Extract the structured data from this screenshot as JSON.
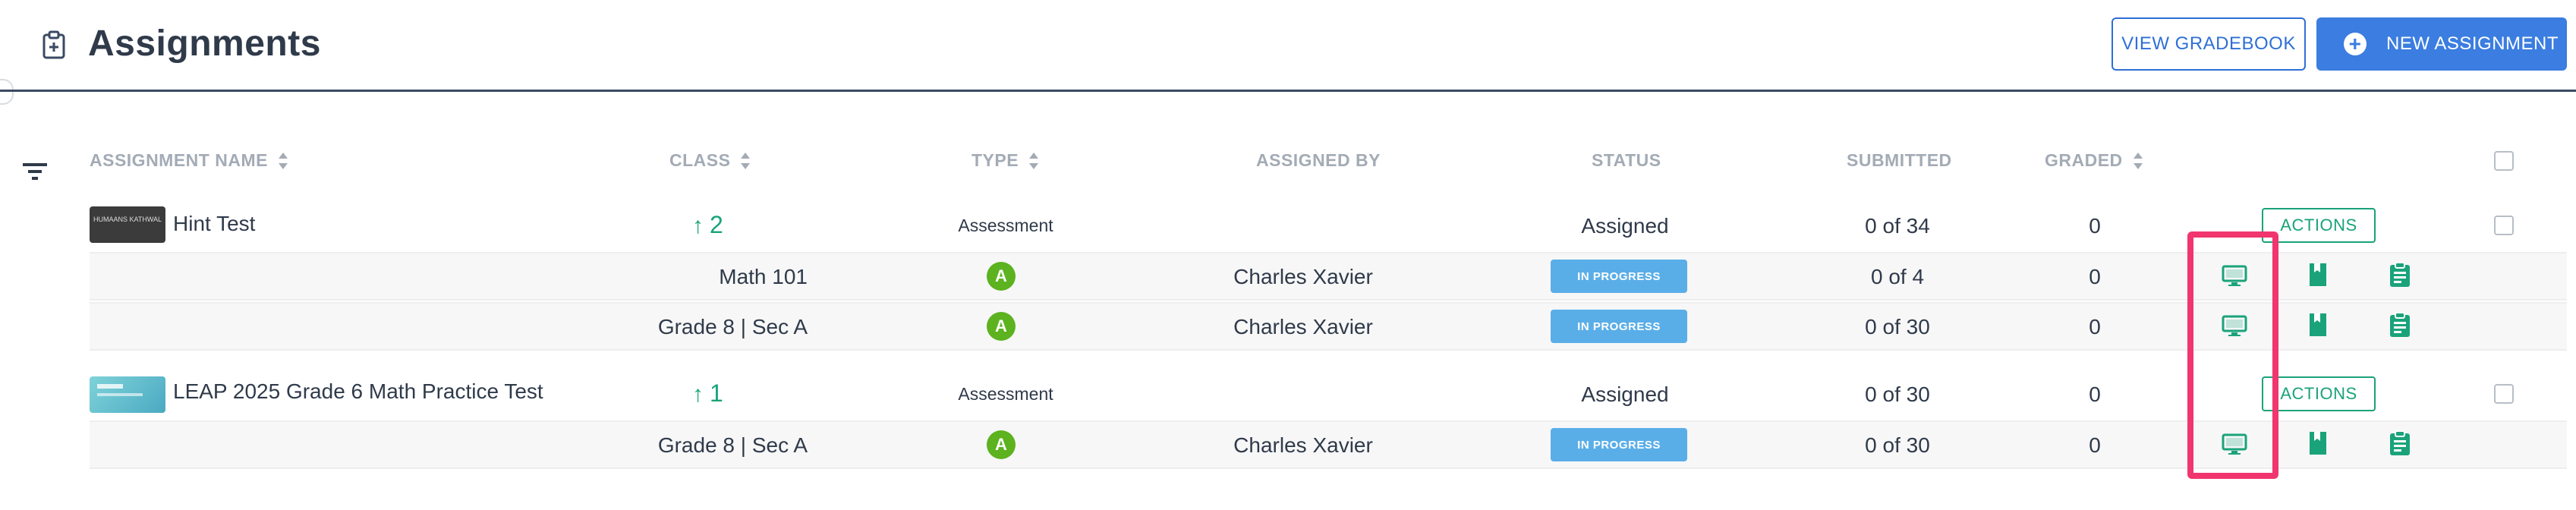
{
  "header": {
    "title": "Assignments",
    "view_gradebook_label": "VIEW GRADEBOOK",
    "new_assignment_label": "NEW ASSIGNMENT"
  },
  "columns": {
    "assignment_name": "ASSIGNMENT NAME",
    "class": "CLASS",
    "type": "TYPE",
    "assigned_by": "ASSIGNED BY",
    "status": "STATUS",
    "submitted": "SUBMITTED",
    "graded": "GRADED"
  },
  "assignments": [
    {
      "name": "Hint Test",
      "thumbnail_text": "HUMAANS KATHWAL",
      "class_count": "2",
      "type": "Assessment",
      "status": "Assigned",
      "submitted": "0 of 34",
      "graded": "0",
      "actions_label": "ACTIONS",
      "classes": [
        {
          "class": "Math 101",
          "type_badge": "A",
          "assigned_by": "Charles Xavier",
          "status": "IN PROGRESS",
          "submitted": "0 of 4",
          "graded": "0"
        },
        {
          "class": "Grade 8 | Sec A",
          "type_badge": "A",
          "assigned_by": "Charles Xavier",
          "status": "IN PROGRESS",
          "submitted": "0 of 30",
          "graded": "0"
        }
      ]
    },
    {
      "name": "LEAP 2025 Grade 6 Math Practice Test",
      "class_count": "1",
      "type": "Assessment",
      "status": "Assigned",
      "submitted": "0 of 30",
      "graded": "0",
      "actions_label": "ACTIONS",
      "classes": [
        {
          "class": "Grade 8 | Sec A",
          "type_badge": "A",
          "assigned_by": "Charles Xavier",
          "status": "IN PROGRESS",
          "submitted": "0 of 30",
          "graded": "0"
        }
      ]
    }
  ],
  "icons": {
    "header": "clipboard-icon",
    "filter": "filter-icon",
    "row_actions": [
      "monitor-icon",
      "book-icon",
      "clipboard-list-icon"
    ]
  },
  "colors": {
    "primary": "#3b7de0",
    "accent_green": "#1aa37a",
    "in_progress": "#5aaee8",
    "type_badge": "#5cb21f",
    "highlight": "#f0356f"
  }
}
